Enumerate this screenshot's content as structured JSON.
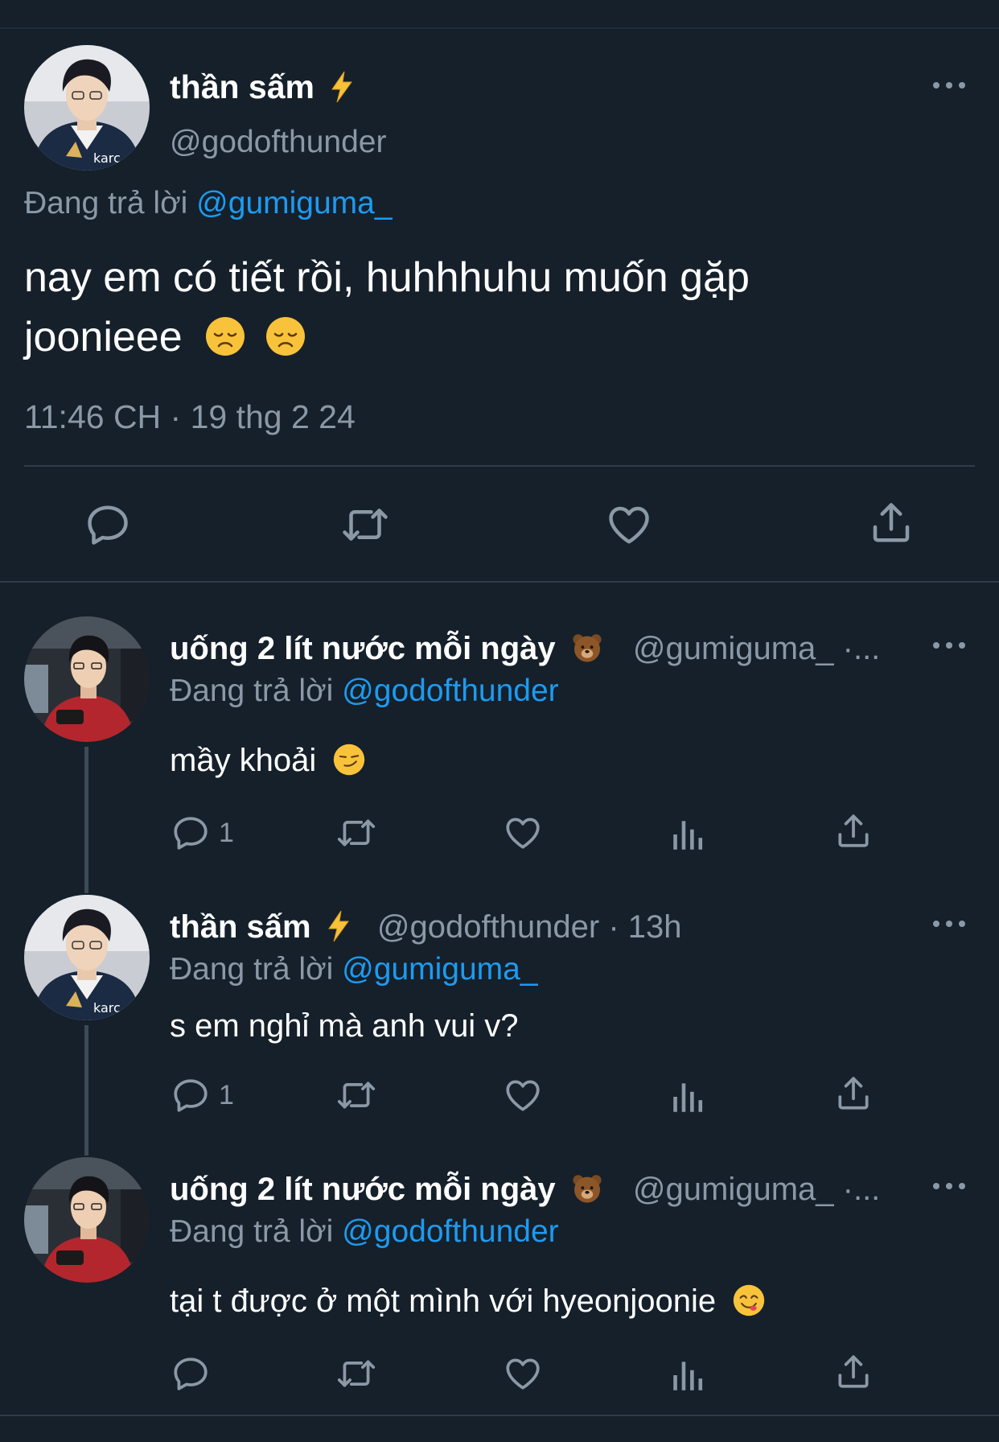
{
  "main_tweet": {
    "display_name": "thần sấm",
    "name_emoji": "⚡",
    "handle": "@godofthunder",
    "replying_label": "Đang trả lời",
    "replying_to": "@gumiguma_",
    "text_line1": "nay em có tiết rồi, huhhhuhu muốn gặp",
    "text_line2": "joonieee",
    "timestamp": "11:46 CH · 19 thg 2 24",
    "actions": [
      "reply-icon",
      "retweet-icon",
      "like-icon",
      "share-icon"
    ]
  },
  "replies": [
    {
      "display_name": "uống 2 lít nước mỗi ngày",
      "name_emoji": "🐻",
      "handle": "@gumiguma_ ·...",
      "replying_label": "Đang trả lời",
      "replying_to": "@godofthunder",
      "text": "mầy khoải",
      "reply_count": "1"
    },
    {
      "display_name": "thần sấm",
      "name_emoji": "⚡",
      "handle": "@godofthunder · 13h",
      "replying_label": "Đang trả lời",
      "replying_to": "@gumiguma_",
      "text": "s em nghỉ mà anh vui v?",
      "reply_count": "1"
    },
    {
      "display_name": "uống 2 lít nước mỗi ngày",
      "name_emoji": "🐻",
      "handle": "@gumiguma_ ·...",
      "replying_label": "Đang trả lời",
      "replying_to": "@godofthunder",
      "text": "tại t được ở một mình với hyeonjoonie",
      "reply_count": ""
    }
  ],
  "colors": {
    "background": "#15202b",
    "text": "#ffffff",
    "muted": "#8b98a5",
    "link": "#1d9bf0"
  }
}
